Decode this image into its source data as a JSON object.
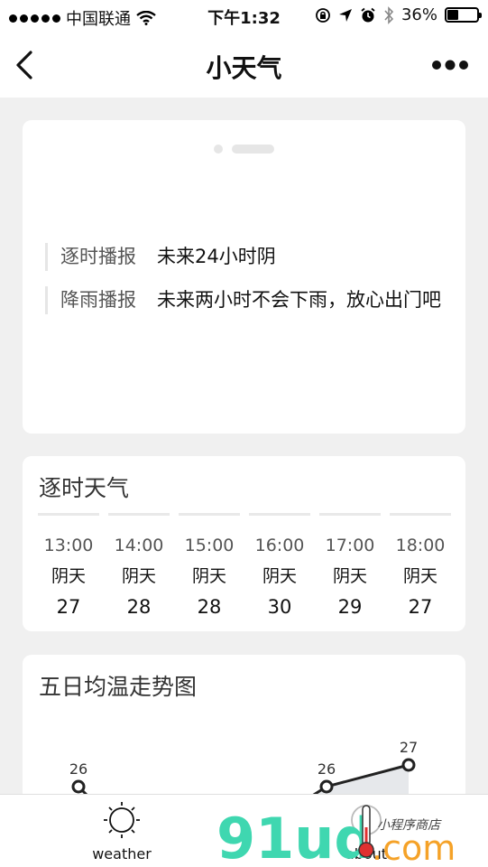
{
  "status_bar": {
    "carrier": "中国联通",
    "time": "下午1:32",
    "battery_percent": "36%",
    "battery_level": 0.36,
    "icons": [
      "signal-dots-icon",
      "wifi-icon",
      "lock-rotation-icon",
      "location-arrow-icon",
      "alarm-icon",
      "bluetooth-icon",
      "battery-icon"
    ]
  },
  "nav": {
    "title": "小天气",
    "back_icon": "chevron-left-icon",
    "more_icon": "more-dots-icon"
  },
  "reports": [
    {
      "label": "逐时播报",
      "text": "未来24小时阴"
    },
    {
      "label": "降雨播报",
      "text": "未来两小时不会下雨，放心出门吧"
    }
  ],
  "hourly": {
    "title": "逐时天气",
    "hours": [
      {
        "time": "13:00",
        "weather": "阴天",
        "temp": "27"
      },
      {
        "time": "14:00",
        "weather": "阴天",
        "temp": "28"
      },
      {
        "time": "15:00",
        "weather": "阴天",
        "temp": "28"
      },
      {
        "time": "16:00",
        "weather": "阴天",
        "temp": "30"
      },
      {
        "time": "17:00",
        "weather": "阴天",
        "temp": "29"
      },
      {
        "time": "18:00",
        "weather": "阴天",
        "temp": "27"
      }
    ]
  },
  "trend": {
    "title": "五日均温走势图",
    "chart_data": {
      "type": "line",
      "series": [
        {
          "values": [
            26,
            null,
            null,
            26,
            27
          ]
        }
      ],
      "visible_labels": [
        "26",
        "26",
        "27"
      ]
    }
  },
  "tab_bar": {
    "items": [
      {
        "label": "weather",
        "icon": "sun-icon"
      },
      {
        "label": "about",
        "icon": "info-icon"
      }
    ]
  },
  "watermark": {
    "main": "91ud",
    "suffix": ".com",
    "small": "小程序商店"
  },
  "colors": {
    "background": "#f0f0f0",
    "card": "#ffffff",
    "watermark_green": "#3fd7b0",
    "watermark_orange": "#f5a228"
  }
}
